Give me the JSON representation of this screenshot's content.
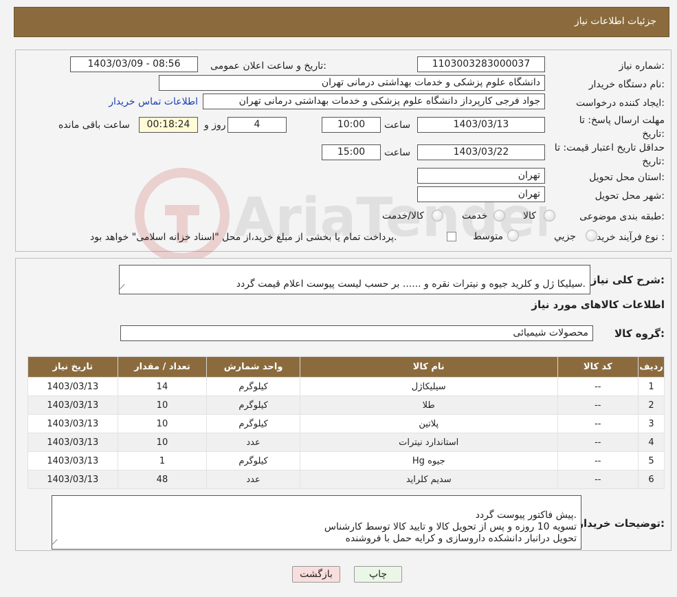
{
  "header": {
    "title": "جزئیات اطلاعات نیاز"
  },
  "info": {
    "need_number_label": "شماره نیاز:",
    "need_number": "1103003283000037",
    "announce_label": "تاریخ و ساعت اعلان عمومی:",
    "announce_value": "1403/03/09 - 08:56",
    "buyer_org_label": "نام دستگاه خریدار:",
    "buyer_org": "دانشگاه علوم پزشکی و خدمات بهداشتی درمانی تهران",
    "creator_label": "ایجاد کننده درخواست:",
    "creator": "جواد فرجی کارپرداز دانشگاه علوم پزشکی و خدمات بهداشتی درمانی تهران",
    "contact_link": "اطلاعات تماس خریدار",
    "deadline_label": "مهلت ارسال پاسخ: تا تاریخ:",
    "deadline_date": "1403/03/13",
    "time_label": "ساعت",
    "deadline_time": "10:00",
    "days": "4",
    "days_label": "روز و",
    "remaining": "00:18:24",
    "remaining_label": "ساعت باقی مانده",
    "validity_label": "حداقل تاریخ اعتبار قیمت: تا تاریخ:",
    "validity_date": "1403/03/22",
    "validity_time": "15:00",
    "province_label": "استان محل تحویل:",
    "province": "تهران",
    "city_label": "شهر محل تحویل:",
    "city": "تهران",
    "category_label": "طبقه بندی موضوعی:",
    "category_options": [
      "کالا",
      "خدمت",
      "کالا/خدمت"
    ],
    "process_label": "نوع فرآیند خرید :",
    "process_options": [
      "جزیي",
      "متوسط"
    ],
    "payment_note": "پرداخت تمام یا بخشی از مبلغ خرید،از محل \"اسناد خزانه اسلامی\" خواهد بود."
  },
  "details": {
    "summary_label": "شرح کلی نیاز:",
    "summary": "سیلیکا ژل و کلرید جیوه و نیترات نقره و ...... بر حسب لیست پیوست اعلام قیمت گردد.",
    "goods_info_title": "اطلاعات کالاهای مورد نیاز",
    "group_label": "گروه کالا:",
    "group": "محصولات شیمیائی",
    "buyer_notes_label": "توضیحات خریدار:",
    "buyer_notes": "پیش فاکتور پیوست گردد.\nتسویه 10 روزه و پس از تحویل کالا و تایید کالا توسط کارشناس\nتحویل درانبار دانشکده داروسازی و کرایه حمل با فروشنده"
  },
  "table": {
    "headers": [
      "ردیف",
      "کد کالا",
      "نام کالا",
      "واحد شمارش",
      "تعداد / مقدار",
      "تاریخ نیاز"
    ],
    "rows": [
      [
        "1",
        "--",
        "سیلیکاژل",
        "کیلوگرم",
        "14",
        "1403/03/13"
      ],
      [
        "2",
        "--",
        "طلا",
        "کیلوگرم",
        "10",
        "1403/03/13"
      ],
      [
        "3",
        "--",
        "پلاتین",
        "کیلوگرم",
        "10",
        "1403/03/13"
      ],
      [
        "4",
        "--",
        "استاندارد نیترات",
        "عدد",
        "10",
        "1403/03/13"
      ],
      [
        "5",
        "--",
        "جیوه Hg",
        "کیلوگرم",
        "1",
        "1403/03/13"
      ],
      [
        "6",
        "--",
        "سدیم کلراید",
        "عدد",
        "48",
        "1403/03/13"
      ]
    ]
  },
  "buttons": {
    "print": "چاپ",
    "back": "بازگشت"
  },
  "watermark": {
    "text": "AriaTender.neT"
  },
  "colors": {
    "header_bg": "#8b6b3d",
    "link": "#1a3fb5"
  }
}
